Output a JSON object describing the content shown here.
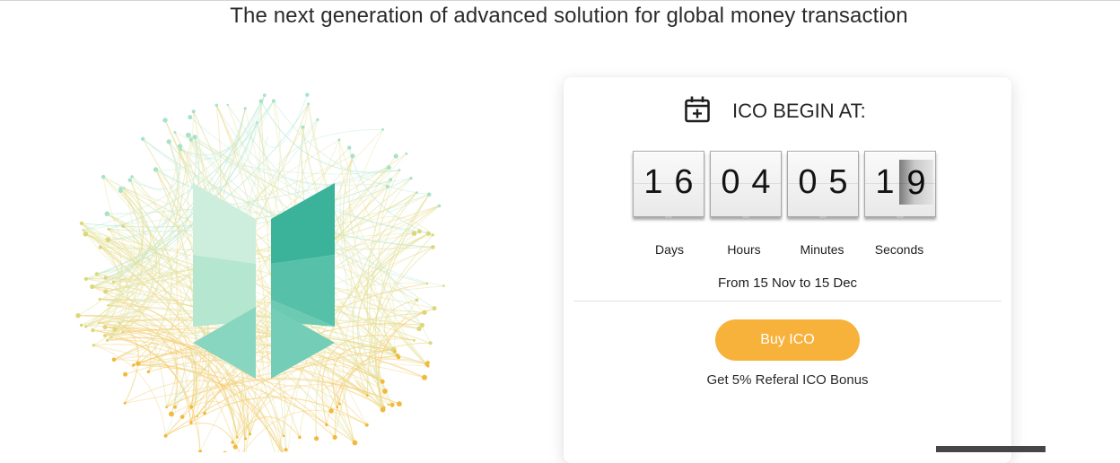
{
  "headline": "The next generation of advanced solution for global money transaction",
  "hero": {
    "logo_icon": "network-globe-logo",
    "colors": {
      "teal": "#3bb39a",
      "mint": "#c9ecdb",
      "gold": "#f3b73a"
    }
  },
  "countdown_card": {
    "title": "ICO BEGIN AT:",
    "title_icon": "calendar-plus-icon",
    "units": [
      {
        "digits": [
          "1",
          "6"
        ],
        "label": "Days"
      },
      {
        "digits": [
          "0",
          "4"
        ],
        "label": "Hours"
      },
      {
        "digits": [
          "0",
          "5"
        ],
        "label": "Minutes"
      },
      {
        "digits": [
          "1",
          "9"
        ],
        "label": "Seconds"
      }
    ],
    "date_range": "From 15 Nov to 15 Dec",
    "buy_button_label": "Buy ICO",
    "bonus_text": "Get 5% Referal ICO Bonus",
    "accent_color": "#f7b23b"
  }
}
